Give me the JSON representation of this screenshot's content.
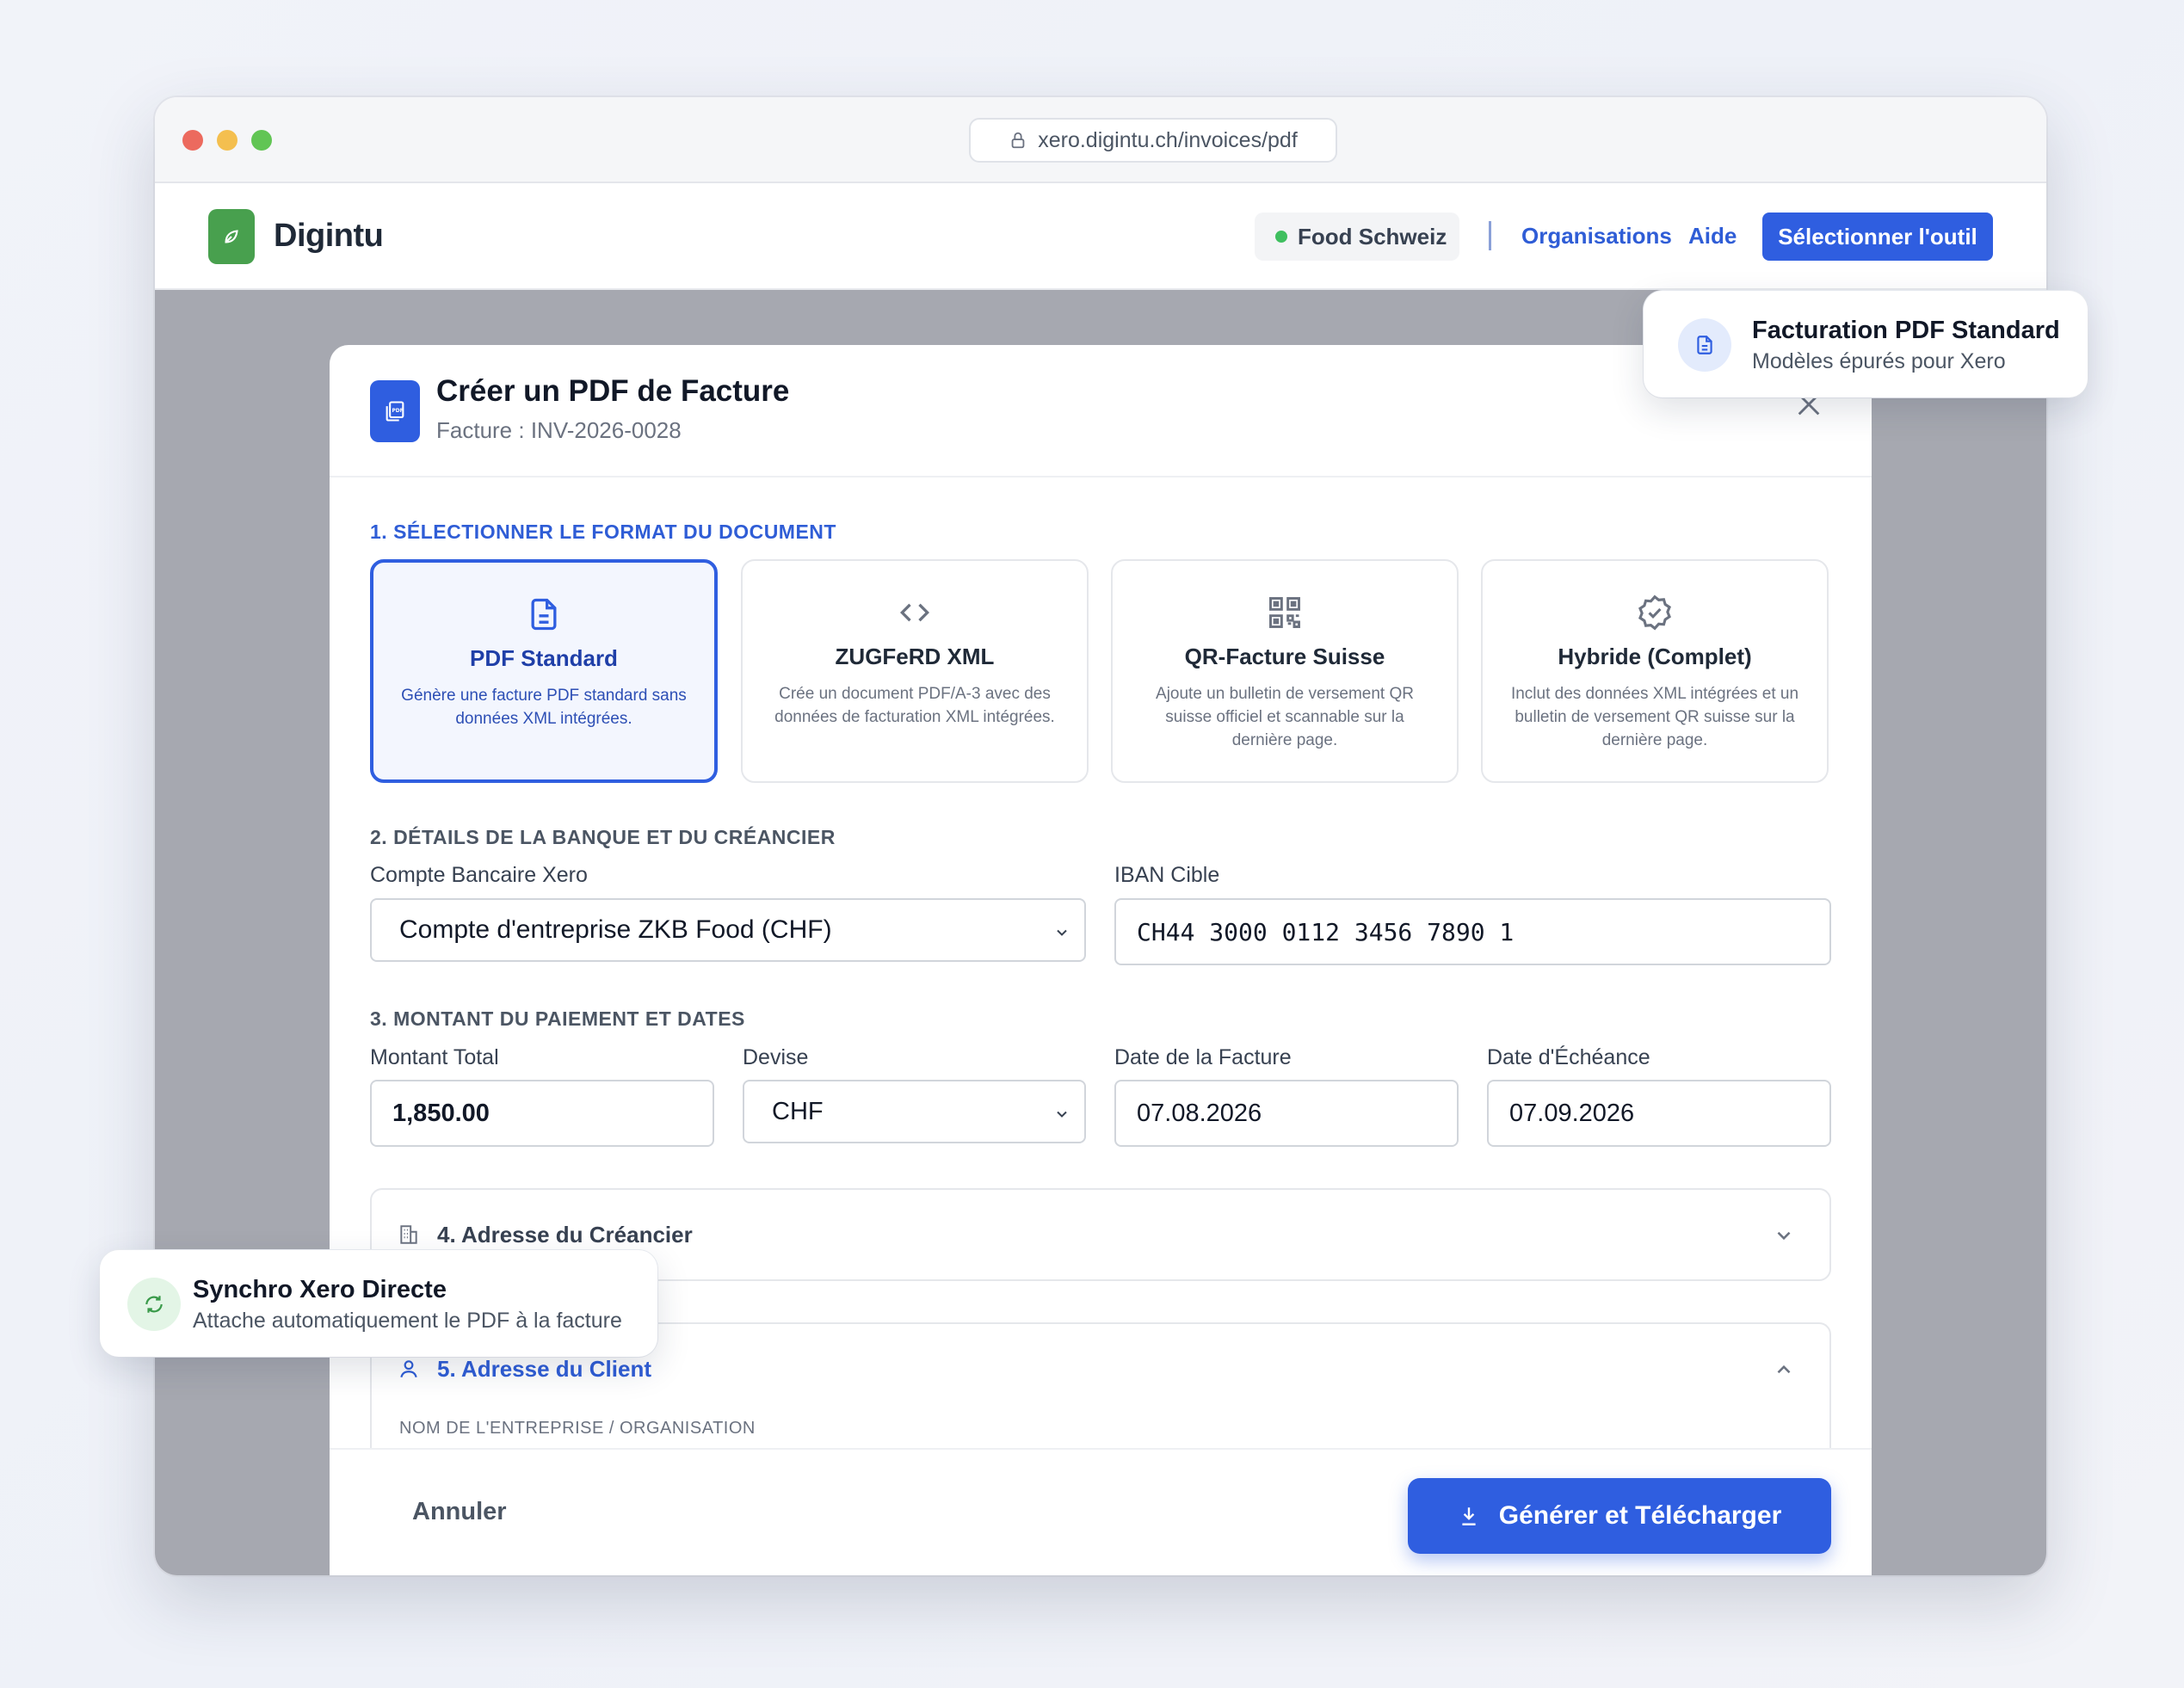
{
  "browser": {
    "url": "xero.digintu.ch/invoices/pdf"
  },
  "header": {
    "brand": "Digintu",
    "organization": "Food Schweiz",
    "nav_organisations": "Organisations",
    "nav_aide": "Aide",
    "select_tool_button": "Sélectionner l'outil"
  },
  "modal": {
    "title": "Créer un PDF de Facture",
    "subtitle": "Facture : INV-2026-0028",
    "section1_title": "1. Sélectionner le format du document",
    "formats": [
      {
        "title": "PDF Standard",
        "description": "Génère une facture PDF standard sans données XML intégrées.",
        "icon": "document-icon",
        "selected": true
      },
      {
        "title": "ZUGFeRD XML",
        "description": "Crée un document PDF/A-3 avec des données de facturation XML intégrées.",
        "icon": "code-icon",
        "selected": false
      },
      {
        "title": "QR-Facture Suisse",
        "description": "Ajoute un bulletin de versement QR suisse officiel et scannable sur la dernière page.",
        "icon": "qr-code-icon",
        "selected": false
      },
      {
        "title": "Hybride (Complet)",
        "description": "Inclut des données XML intégrées et un bulletin de versement QR suisse sur la dernière page.",
        "icon": "badge-check-icon",
        "selected": false
      }
    ],
    "section2_title": "2. Détails de la banque et du créancier",
    "bank_account_label": "Compte Bancaire Xero",
    "bank_account_value": "Compte d'entreprise ZKB Food (CHF)",
    "iban_label": "IBAN Cible",
    "iban_value": "CH44 3000 0112 3456 7890 1",
    "section3_title": "3. Montant du paiement et dates",
    "amount_label": "Montant Total",
    "amount_value": "1,850.00",
    "currency_label": "Devise",
    "currency_value": "CHF",
    "invoice_date_label": "Date de la Facture",
    "invoice_date_value": "07.08.2026",
    "due_date_label": "Date d'Échéance",
    "due_date_value": "07.09.2026",
    "section4_title": "4. Adresse du Créancier",
    "section5_title": "5. Adresse du Client",
    "company_name_label": "NOM DE L'ENTREPRISE / ORGANISATION",
    "cancel_button": "Annuler",
    "generate_button": "Générer et Télécharger"
  },
  "floating": {
    "top_title": "Facturation PDF Standard",
    "top_subtitle": "Modèles épurés pour Xero",
    "bottom_title": "Synchro Xero Directe",
    "bottom_subtitle": "Attache automatiquement le PDF à la facture"
  },
  "colors": {
    "accent": "#2f5ee0",
    "brand_green": "#48a04e",
    "overlay": "#a6a8b0"
  }
}
